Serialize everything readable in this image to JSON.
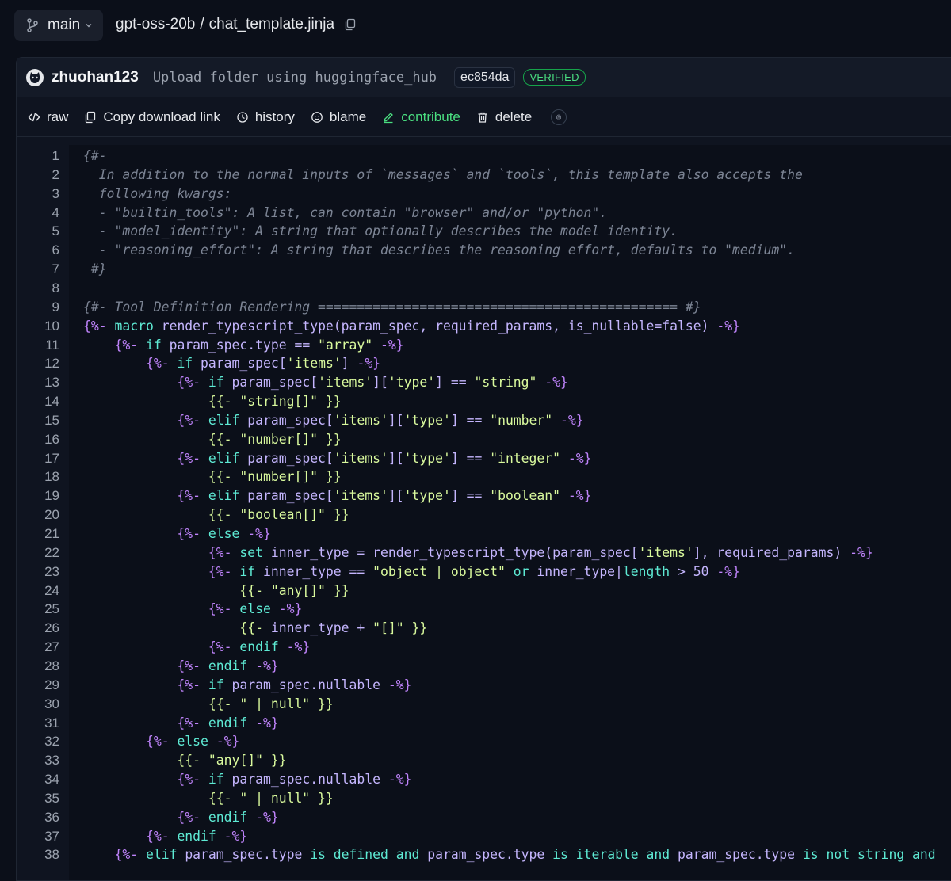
{
  "header": {
    "branch": "main",
    "repo": "gpt-oss-20b",
    "separator": "/",
    "file": "chat_template.jinja"
  },
  "commit": {
    "author": "zhuohan123",
    "message": "Upload folder using huggingface_hub",
    "sha": "ec854da",
    "badge": "VERIFIED"
  },
  "actions": {
    "raw": "raw",
    "copy": "Copy download link",
    "history": "history",
    "blame": "blame",
    "contribute": "contribute",
    "delete": "delete"
  },
  "colors": {
    "background": "#0b0f19",
    "accent_green": "#4ade80",
    "comment": "#7c8494",
    "delimiter": "#c084fc",
    "keyword": "#5eead4",
    "string": "#d9f99d"
  },
  "code_lines": [
    [
      [
        "c",
        "{#-"
      ]
    ],
    [
      [
        "c",
        "  In addition to the normal inputs of `messages` and `tools`, this template also accepts the"
      ]
    ],
    [
      [
        "c",
        "  following kwargs:"
      ]
    ],
    [
      [
        "c",
        "  - \"builtin_tools\": A list, can contain \"browser\" and/or \"python\"."
      ]
    ],
    [
      [
        "c",
        "  - \"model_identity\": A string that optionally describes the model identity."
      ]
    ],
    [
      [
        "c",
        "  - \"reasoning_effort\": A string that describes the reasoning effort, defaults to \"medium\"."
      ]
    ],
    [
      [
        "c",
        " #}"
      ]
    ],
    [
      [
        "c",
        ""
      ]
    ],
    [
      [
        "c",
        "{#- Tool Definition Rendering ============================================== #}"
      ]
    ],
    [
      [
        "d",
        "{%- "
      ],
      [
        "k",
        "macro "
      ],
      [
        "n",
        "render_typescript_type(param_spec, required_params, is_nullable=false) "
      ],
      [
        "d",
        "-%}"
      ]
    ],
    [
      [
        "t",
        "    "
      ],
      [
        "d",
        "{%- "
      ],
      [
        "k",
        "if "
      ],
      [
        "n",
        "param_spec.type == "
      ],
      [
        "s",
        "\"array\" "
      ],
      [
        "d",
        "-%}"
      ]
    ],
    [
      [
        "t",
        "        "
      ],
      [
        "d",
        "{%- "
      ],
      [
        "k",
        "if "
      ],
      [
        "n",
        "param_spec["
      ],
      [
        "s",
        "'items'"
      ],
      [
        "n",
        "] "
      ],
      [
        "d",
        "-%}"
      ]
    ],
    [
      [
        "t",
        "            "
      ],
      [
        "d",
        "{%- "
      ],
      [
        "k",
        "if "
      ],
      [
        "n",
        "param_spec["
      ],
      [
        "s",
        "'items'"
      ],
      [
        "n",
        "]["
      ],
      [
        "s",
        "'type'"
      ],
      [
        "n",
        "] == "
      ],
      [
        "s",
        "\"string\" "
      ],
      [
        "d",
        "-%}"
      ]
    ],
    [
      [
        "t",
        "                "
      ],
      [
        "s",
        "{{- \"string[]\" }}"
      ]
    ],
    [
      [
        "t",
        "            "
      ],
      [
        "d",
        "{%- "
      ],
      [
        "k",
        "elif "
      ],
      [
        "n",
        "param_spec["
      ],
      [
        "s",
        "'items'"
      ],
      [
        "n",
        "]["
      ],
      [
        "s",
        "'type'"
      ],
      [
        "n",
        "] == "
      ],
      [
        "s",
        "\"number\" "
      ],
      [
        "d",
        "-%}"
      ]
    ],
    [
      [
        "t",
        "                "
      ],
      [
        "s",
        "{{- \"number[]\" }}"
      ]
    ],
    [
      [
        "t",
        "            "
      ],
      [
        "d",
        "{%- "
      ],
      [
        "k",
        "elif "
      ],
      [
        "n",
        "param_spec["
      ],
      [
        "s",
        "'items'"
      ],
      [
        "n",
        "]["
      ],
      [
        "s",
        "'type'"
      ],
      [
        "n",
        "] == "
      ],
      [
        "s",
        "\"integer\" "
      ],
      [
        "d",
        "-%}"
      ]
    ],
    [
      [
        "t",
        "                "
      ],
      [
        "s",
        "{{- \"number[]\" }}"
      ]
    ],
    [
      [
        "t",
        "            "
      ],
      [
        "d",
        "{%- "
      ],
      [
        "k",
        "elif "
      ],
      [
        "n",
        "param_spec["
      ],
      [
        "s",
        "'items'"
      ],
      [
        "n",
        "]["
      ],
      [
        "s",
        "'type'"
      ],
      [
        "n",
        "] == "
      ],
      [
        "s",
        "\"boolean\" "
      ],
      [
        "d",
        "-%}"
      ]
    ],
    [
      [
        "t",
        "                "
      ],
      [
        "s",
        "{{- \"boolean[]\" }}"
      ]
    ],
    [
      [
        "t",
        "            "
      ],
      [
        "d",
        "{%- "
      ],
      [
        "k",
        "else "
      ],
      [
        "d",
        "-%}"
      ]
    ],
    [
      [
        "t",
        "                "
      ],
      [
        "d",
        "{%- "
      ],
      [
        "k",
        "set "
      ],
      [
        "n",
        "inner_type = render_typescript_type(param_spec["
      ],
      [
        "s",
        "'items'"
      ],
      [
        "n",
        "], required_params) "
      ],
      [
        "d",
        "-%}"
      ]
    ],
    [
      [
        "t",
        "                "
      ],
      [
        "d",
        "{%- "
      ],
      [
        "k",
        "if "
      ],
      [
        "n",
        "inner_type == "
      ],
      [
        "s",
        "\"object | object\" "
      ],
      [
        "k",
        "or "
      ],
      [
        "n",
        "inner_type|"
      ],
      [
        "k",
        "length "
      ],
      [
        "n",
        "> 50 "
      ],
      [
        "d",
        "-%}"
      ]
    ],
    [
      [
        "t",
        "                    "
      ],
      [
        "s",
        "{{- \"any[]\" }}"
      ]
    ],
    [
      [
        "t",
        "                "
      ],
      [
        "d",
        "{%- "
      ],
      [
        "k",
        "else "
      ],
      [
        "d",
        "-%}"
      ]
    ],
    [
      [
        "t",
        "                    "
      ],
      [
        "s",
        "{{- "
      ],
      [
        "n",
        "inner_type + "
      ],
      [
        "s",
        "\"[]\" }}"
      ]
    ],
    [
      [
        "t",
        "                "
      ],
      [
        "d",
        "{%- "
      ],
      [
        "k",
        "endif "
      ],
      [
        "d",
        "-%}"
      ]
    ],
    [
      [
        "t",
        "            "
      ],
      [
        "d",
        "{%- "
      ],
      [
        "k",
        "endif "
      ],
      [
        "d",
        "-%}"
      ]
    ],
    [
      [
        "t",
        "            "
      ],
      [
        "d",
        "{%- "
      ],
      [
        "k",
        "if "
      ],
      [
        "n",
        "param_spec.nullable "
      ],
      [
        "d",
        "-%}"
      ]
    ],
    [
      [
        "t",
        "                "
      ],
      [
        "s",
        "{{- \" | null\" }}"
      ]
    ],
    [
      [
        "t",
        "            "
      ],
      [
        "d",
        "{%- "
      ],
      [
        "k",
        "endif "
      ],
      [
        "d",
        "-%}"
      ]
    ],
    [
      [
        "t",
        "        "
      ],
      [
        "d",
        "{%- "
      ],
      [
        "k",
        "else "
      ],
      [
        "d",
        "-%}"
      ]
    ],
    [
      [
        "t",
        "            "
      ],
      [
        "s",
        "{{- \"any[]\" }}"
      ]
    ],
    [
      [
        "t",
        "            "
      ],
      [
        "d",
        "{%- "
      ],
      [
        "k",
        "if "
      ],
      [
        "n",
        "param_spec.nullable "
      ],
      [
        "d",
        "-%}"
      ]
    ],
    [
      [
        "t",
        "                "
      ],
      [
        "s",
        "{{- \" | null\" }}"
      ]
    ],
    [
      [
        "t",
        "            "
      ],
      [
        "d",
        "{%- "
      ],
      [
        "k",
        "endif "
      ],
      [
        "d",
        "-%}"
      ]
    ],
    [
      [
        "t",
        "        "
      ],
      [
        "d",
        "{%- "
      ],
      [
        "k",
        "endif "
      ],
      [
        "d",
        "-%}"
      ]
    ],
    [
      [
        "t",
        "    "
      ],
      [
        "d",
        "{%- "
      ],
      [
        "k",
        "elif "
      ],
      [
        "n",
        "param_spec.type "
      ],
      [
        "k",
        "is defined and "
      ],
      [
        "n",
        "param_spec.type "
      ],
      [
        "k",
        "is iterable and "
      ],
      [
        "n",
        "param_spec.type "
      ],
      [
        "k",
        "is not string and"
      ]
    ]
  ]
}
